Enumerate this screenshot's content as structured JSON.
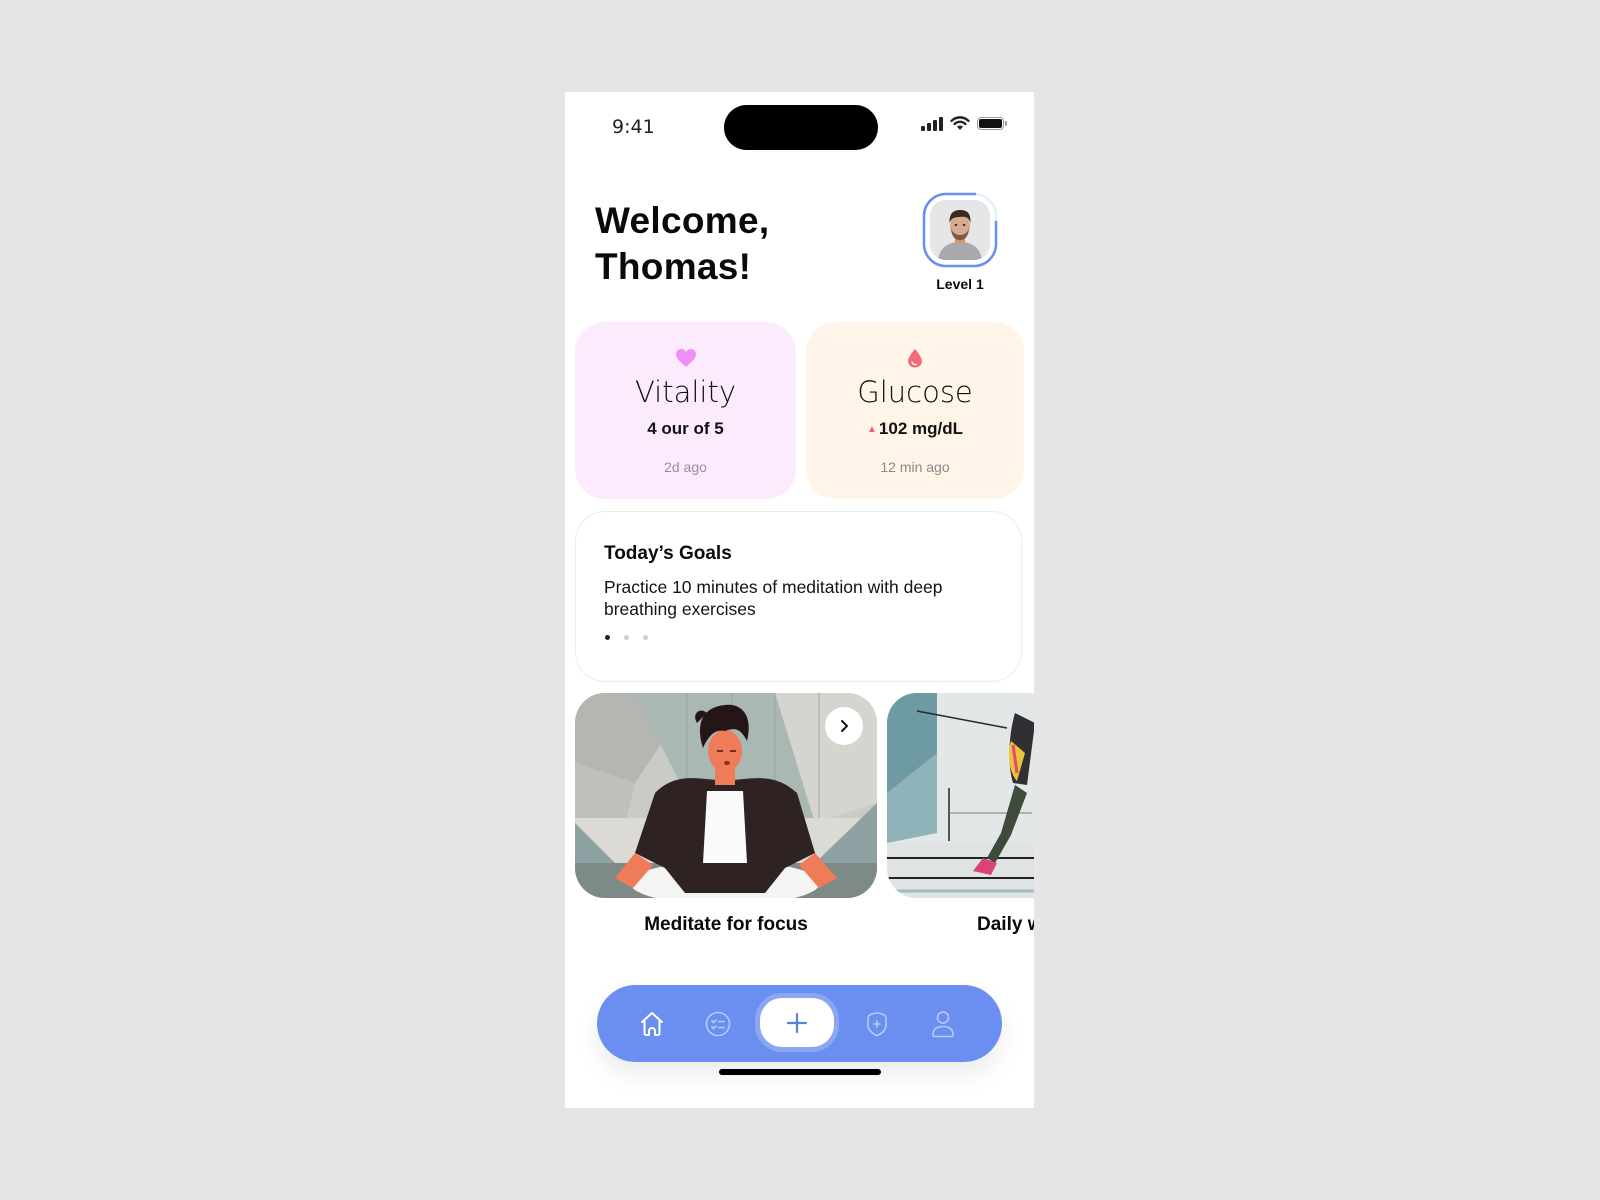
{
  "status_bar": {
    "time": "9:41",
    "icons": [
      "cellular-signal-icon",
      "wifi-icon",
      "battery-icon"
    ]
  },
  "header": {
    "greeting_line1": "Welcome,",
    "greeting_line2": "Thomas!",
    "avatar_icon": "user-avatar-photo",
    "level_label": "Level 1",
    "level_progress_percent": 85
  },
  "metrics": [
    {
      "icon": "heart-icon",
      "title": "Vitality",
      "value": "4 our of 5",
      "updated": "2d ago",
      "bg_color": "#fcebfd",
      "icon_color": "#ee91f5"
    },
    {
      "icon": "blood-drop-icon",
      "title": "Glucose",
      "trend_icon": "up-triangle-icon",
      "value": "102 mg/dL",
      "updated": "12 min ago",
      "bg_color": "#fef5e8",
      "icon_color": "#f06d7c"
    }
  ],
  "goals": {
    "title": "Today’s Goals",
    "text": "Practice 10 minutes of meditation with deep breathing exercises",
    "pages": 3,
    "active_page": 1
  },
  "media": [
    {
      "label": "Meditate for focus",
      "image": "meditation-illustration",
      "action_icon": "chevron-right-icon"
    },
    {
      "label": "Daily walk",
      "image": "running-illustration"
    }
  ],
  "nav": {
    "accent_color": "#6a8ff0",
    "items": [
      {
        "name": "home",
        "icon": "home-icon",
        "active": true
      },
      {
        "name": "tasks",
        "icon": "checklist-icon",
        "active": false
      },
      {
        "name": "add",
        "icon": "plus-icon",
        "active": false
      },
      {
        "name": "health",
        "icon": "shield-plus-icon",
        "active": false
      },
      {
        "name": "profile",
        "icon": "user-icon",
        "active": false
      }
    ]
  }
}
